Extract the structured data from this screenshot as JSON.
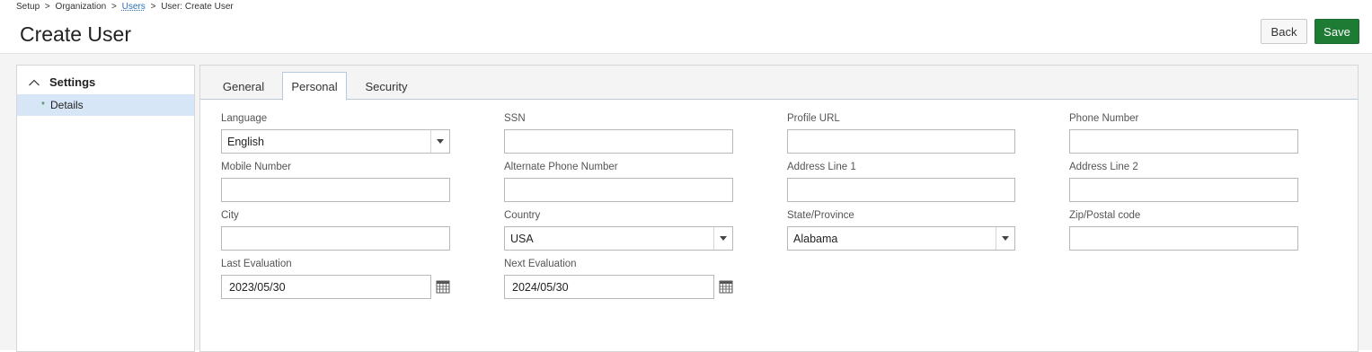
{
  "breadcrumb": {
    "setup": "Setup",
    "organization": "Organization",
    "users": "Users",
    "current": "User: Create User",
    "separator": ">"
  },
  "page_title": "Create User",
  "actions": {
    "back": "Back",
    "save": "Save"
  },
  "sidebar": {
    "section": "Settings",
    "items": [
      {
        "label": "Details",
        "marker": "*"
      }
    ]
  },
  "tabs": {
    "general": "General",
    "personal": "Personal",
    "security": "Security",
    "active": "Personal"
  },
  "form": {
    "language": {
      "label": "Language",
      "value": "English"
    },
    "ssn": {
      "label": "SSN",
      "value": ""
    },
    "profile_url": {
      "label": "Profile URL",
      "value": ""
    },
    "phone_number": {
      "label": "Phone Number",
      "value": ""
    },
    "mobile_number": {
      "label": "Mobile Number",
      "value": ""
    },
    "alternate_phone": {
      "label": "Alternate Phone Number",
      "value": ""
    },
    "address_line_1": {
      "label": "Address Line 1",
      "value": ""
    },
    "address_line_2": {
      "label": "Address Line 2",
      "value": ""
    },
    "city": {
      "label": "City",
      "value": ""
    },
    "country": {
      "label": "Country",
      "value": "USA"
    },
    "state": {
      "label": "State/Province",
      "value": "Alabama"
    },
    "zip": {
      "label": "Zip/Postal code",
      "value": ""
    },
    "last_evaluation": {
      "label": "Last Evaluation",
      "value": "2023/05/30"
    },
    "next_evaluation": {
      "label": "Next Evaluation",
      "value": "2024/05/30"
    }
  },
  "colors": {
    "accent": "#1e7b34",
    "link": "#2f6fb5",
    "selected_row": "#d6e6f7"
  }
}
